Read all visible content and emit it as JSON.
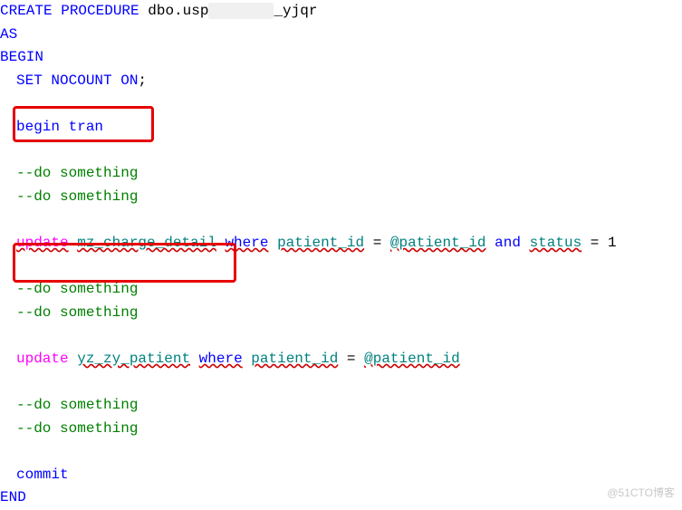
{
  "lines": {
    "create_procedure": "CREATE PROCEDURE",
    "dbo_usp": "dbo.usp",
    "suffix_yjqr": "_yjqr",
    "as": "AS",
    "begin": "BEGIN",
    "set_nocount": "SET NOCOUNT ON",
    "semicolon": ";",
    "begin_tran": "begin tran",
    "do_something": "--do something",
    "update": "update",
    "mz_charge_detail": "mz_charge_detail",
    "where": "where",
    "patient_id_col": "patient_id",
    "equals": " = ",
    "patient_id_param": "@patient_id",
    "and": "and",
    "status_col": "status",
    "one": "1",
    "yz_zy_patient": "yz_zy_patient",
    "commit": "commit",
    "end": "END"
  },
  "watermark": "@51CTO博客"
}
